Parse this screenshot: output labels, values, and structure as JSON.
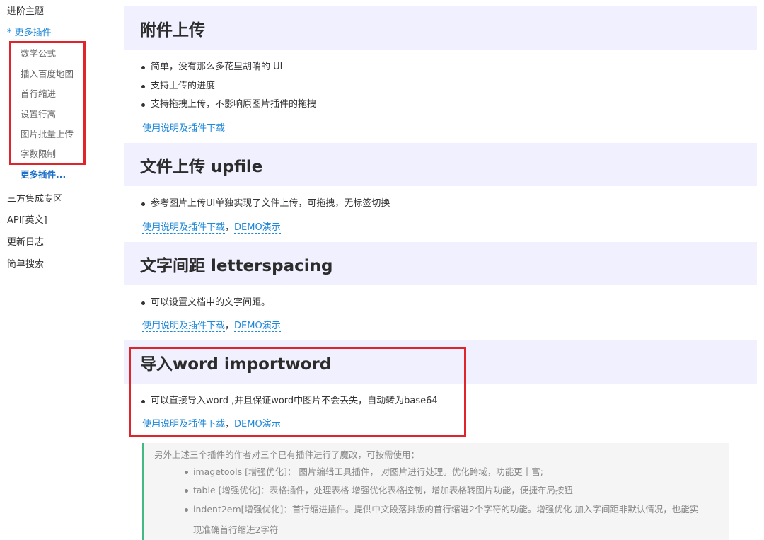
{
  "sidebar": {
    "items": [
      {
        "label": "进阶主题"
      },
      {
        "label": "* 更多插件"
      },
      {
        "label": "三方集成专区"
      },
      {
        "label": "API[英文]"
      },
      {
        "label": "更新日志"
      },
      {
        "label": "简单搜索"
      }
    ],
    "sub_items": [
      {
        "label": "数学公式"
      },
      {
        "label": "插入百度地图"
      },
      {
        "label": "首行缩进"
      },
      {
        "label": "设置行高"
      },
      {
        "label": "图片批量上传"
      },
      {
        "label": "字数限制"
      }
    ],
    "more_label": "更多插件..."
  },
  "sections": [
    {
      "title": "附件上传",
      "bullets": [
        "简单，没有那么多花里胡哨的 UI",
        "支持上传的进度",
        "支持拖拽上传，不影响原图片插件的拖拽"
      ],
      "link_docs": "使用说明及插件下载"
    },
    {
      "title": "文件上传 upfile",
      "bullets": [
        "参考图片上传UI单独实现了文件上传，可拖拽，无标签切换"
      ],
      "link_docs": "使用说明及插件下载",
      "separator": "，",
      "link_demo": "DEMO演示"
    },
    {
      "title": "文字间距 letterspacing",
      "bullets": [
        "可以设置文档中的文字间距。"
      ],
      "link_docs": "使用说明及插件下载",
      "separator": "，",
      "link_demo": "DEMO演示"
    },
    {
      "title": "导入word importword",
      "bullets": [
        "可以直接导入word ,并且保证word中图片不会丢失，自动转为base64"
      ],
      "link_docs": "使用说明及插件下载",
      "separator": "，",
      "link_demo": "DEMO演示"
    }
  ],
  "quote": {
    "intro": "另外上述三个插件的作者对三个已有插件进行了魔改，可按需使用：",
    "items": [
      "imagetools [增强优化]： 图片编辑工具插件， 对图片进行处理。优化跨域，功能更丰富;",
      "table [增强优化]：表格插件，处理表格 增强优化表格控制，增加表格转图片功能，便捷布局按钮",
      "indent2em[增强优化]：首行缩进插件。提供中文段落排版的首行缩进2个字符的功能。增强优化 加入字间距非默认情况，也能实"
    ],
    "continuation": "现准确首行缩进2字符"
  },
  "colors": {
    "accent": "#1e88d9",
    "highlight_box": "#e0242c",
    "section_bg": "#f0f0fe",
    "quote_border": "#42b983"
  }
}
